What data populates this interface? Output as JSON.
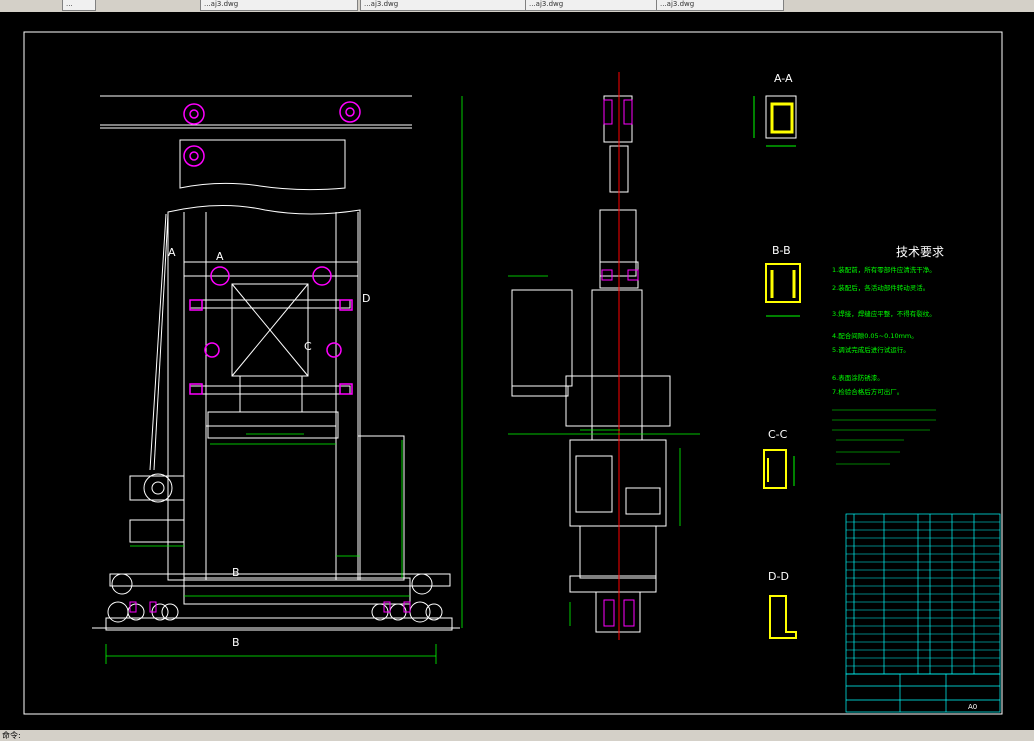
{
  "tabs": [
    {
      "label": "..."
    },
    {
      "label": "...aj3.dwg"
    },
    {
      "label": "...aj3.dwg"
    },
    {
      "label": "...aj3.dwg"
    },
    {
      "label": "...aj3.dwg"
    }
  ],
  "drawing": {
    "sections": {
      "aa": "A-A",
      "bb": "B-B",
      "cc": "C-C",
      "dd": "D-D"
    },
    "tech_title": "技术要求",
    "tech_notes": [
      "1.装配前，所有零部件应清洗干净。",
      "2.装配后，各活动部件转动灵活。",
      "3.焊接，焊缝应平整，不得有裂纹。",
      "4.配合间隙0.05~0.10mm。",
      "5.调试完成后进行试运行。",
      "6.表面涂防锈漆。",
      "7.检验合格后方可出厂。"
    ],
    "view_labels": {
      "a_left": "A",
      "a_right": "A",
      "b_mid": "B",
      "b_bottom": "B",
      "c": "C",
      "d": "D"
    },
    "title_block": {
      "sheet": "A0"
    }
  },
  "statusbar": {
    "text": "命令:"
  },
  "colors": {
    "background": "#000000",
    "lines": "#ffffff",
    "dimension": "#00ff00",
    "centerline": "#ff0000",
    "cyan": "#00ffff",
    "magenta": "#ff00ff",
    "yellow": "#ffff00"
  }
}
